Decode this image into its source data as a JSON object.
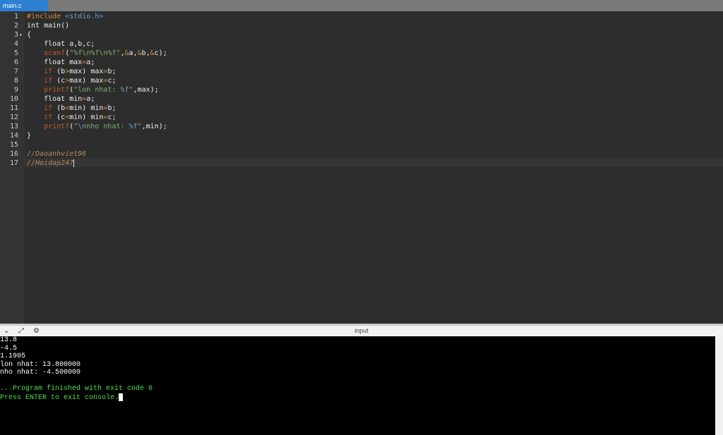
{
  "tab": {
    "filename": "main.c"
  },
  "editor": {
    "lines": [
      {
        "n": "1",
        "fold": ""
      },
      {
        "n": "2",
        "fold": ""
      },
      {
        "n": "3",
        "fold": "▾"
      },
      {
        "n": "4",
        "fold": ""
      },
      {
        "n": "5",
        "fold": ""
      },
      {
        "n": "6",
        "fold": ""
      },
      {
        "n": "7",
        "fold": ""
      },
      {
        "n": "8",
        "fold": ""
      },
      {
        "n": "9",
        "fold": ""
      },
      {
        "n": "10",
        "fold": ""
      },
      {
        "n": "11",
        "fold": ""
      },
      {
        "n": "12",
        "fold": ""
      },
      {
        "n": "13",
        "fold": ""
      },
      {
        "n": "14",
        "fold": ""
      },
      {
        "n": "15",
        "fold": ""
      },
      {
        "n": "16",
        "fold": ""
      },
      {
        "n": "17",
        "fold": ""
      }
    ],
    "code": {
      "l1_pre": "#include ",
      "l1_hdr": "<stdio.h>",
      "l2": "int main()",
      "l3": "{",
      "l4": "    float a,b,c;",
      "l5_fn": "scanf",
      "l5_open": "(",
      "l5_str": "\"%f\\n%f\\n%f\"",
      "l5_rest1": ",",
      "l5_amp1": "&",
      "l5_a": "a,",
      "l5_amp2": "&",
      "l5_b": "b,",
      "l5_amp3": "&",
      "l5_c": "c);",
      "l6_a": "    float max",
      "l6_op": "=",
      "l6_b": "a;",
      "l7_kw": "if",
      "l7_a": " (b",
      "l7_op": ">",
      "l7_b": "max) max",
      "l7_op2": "=",
      "l7_c": "b;",
      "l8_kw": "if",
      "l8_a": " (c",
      "l8_op": ">",
      "l8_b": "max) max",
      "l8_op2": "=",
      "l8_c": "c;",
      "l9_fn": "printf",
      "l9_open": "(",
      "l9_str": "\"lon nhat: ",
      "l9_fmt": "%f",
      "l9_str2": "\"",
      "l9_rest": ",max);",
      "l10_a": "    float min",
      "l10_op": "=",
      "l10_b": "a;",
      "l11_kw": "if",
      "l11_a": " (b",
      "l11_op": "<",
      "l11_b": "min) min",
      "l11_op2": "=",
      "l11_c": "b;",
      "l12_kw": "if",
      "l12_a": " (c",
      "l12_op": "<",
      "l12_b": "min) min",
      "l12_op2": "=",
      "l12_c": "c;",
      "l13_fn": "printf",
      "l13_open": "(",
      "l13_str": "\"",
      "l13_esc": "\\n",
      "l13_str2": "nho nhat: ",
      "l13_fmt": "%f",
      "l13_str3": "\"",
      "l13_rest": ",min);",
      "l14": "}",
      "l16": "//Daoanhviet96",
      "l17": "//Hoidap247"
    }
  },
  "console": {
    "title": "input",
    "output": [
      "13.8",
      "-4.5",
      "1.1905",
      "lon nhat: 13.800000",
      "nho nhat: -4.500000"
    ],
    "finished": "...Program finished with exit code 0",
    "press_enter": "Press ENTER to exit console."
  },
  "icons": [
    "chevron-down-icon",
    "expand-icon",
    "settings-icon"
  ]
}
